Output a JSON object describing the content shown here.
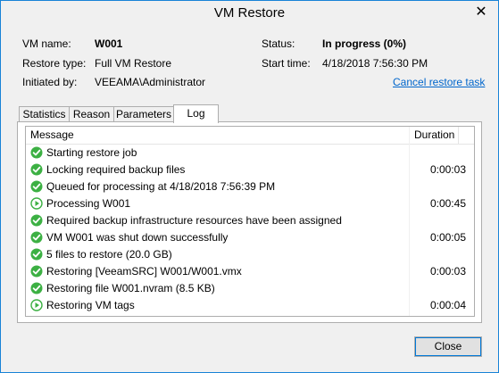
{
  "window": {
    "title": "VM Restore",
    "close_glyph": "✕"
  },
  "info": {
    "vm_name_label": "VM name:",
    "vm_name_value": "W001",
    "restore_type_label": "Restore type:",
    "restore_type_value": "Full VM Restore",
    "initiated_by_label": "Initiated by:",
    "initiated_by_value": "VEEAMA\\Administrator",
    "status_label": "Status:",
    "status_value": "In progress (0%)",
    "start_time_label": "Start time:",
    "start_time_value": "4/18/2018 7:56:30 PM",
    "cancel_link": "Cancel restore task"
  },
  "tabs": [
    {
      "label": "Statistics"
    },
    {
      "label": "Reason"
    },
    {
      "label": "Parameters"
    },
    {
      "label": "Log",
      "active": true
    }
  ],
  "log": {
    "col_message": "Message",
    "col_duration": "Duration",
    "rows": [
      {
        "icon": "success-check-icon",
        "message": "Starting restore job",
        "duration": ""
      },
      {
        "icon": "success-check-icon",
        "message": "Locking required backup files",
        "duration": "0:00:03"
      },
      {
        "icon": "success-check-icon",
        "message": "Queued for processing at 4/18/2018 7:56:39 PM",
        "duration": ""
      },
      {
        "icon": "in-progress-play-icon",
        "message": "Processing W001",
        "duration": "0:00:45"
      },
      {
        "icon": "success-check-icon",
        "message": "Required backup infrastructure resources have been assigned",
        "duration": ""
      },
      {
        "icon": "success-check-icon",
        "message": "VM W001 was shut down successfully",
        "duration": "0:00:05"
      },
      {
        "icon": "success-check-icon",
        "message": "5 files to restore (20.0 GB)",
        "duration": ""
      },
      {
        "icon": "success-check-icon",
        "message": "Restoring [VeeamSRC] W001/W001.vmx",
        "duration": "0:00:03"
      },
      {
        "icon": "success-check-icon",
        "message": "Restoring file W001.nvram (8.5 KB)",
        "duration": ""
      },
      {
        "icon": "in-progress-play-icon",
        "message": "Restoring VM tags",
        "duration": "0:00:04"
      }
    ]
  },
  "buttons": {
    "close_label": "Close"
  },
  "colors": {
    "success": "#3cb043",
    "link": "#0066cc",
    "accent_border": "#1883d7"
  }
}
